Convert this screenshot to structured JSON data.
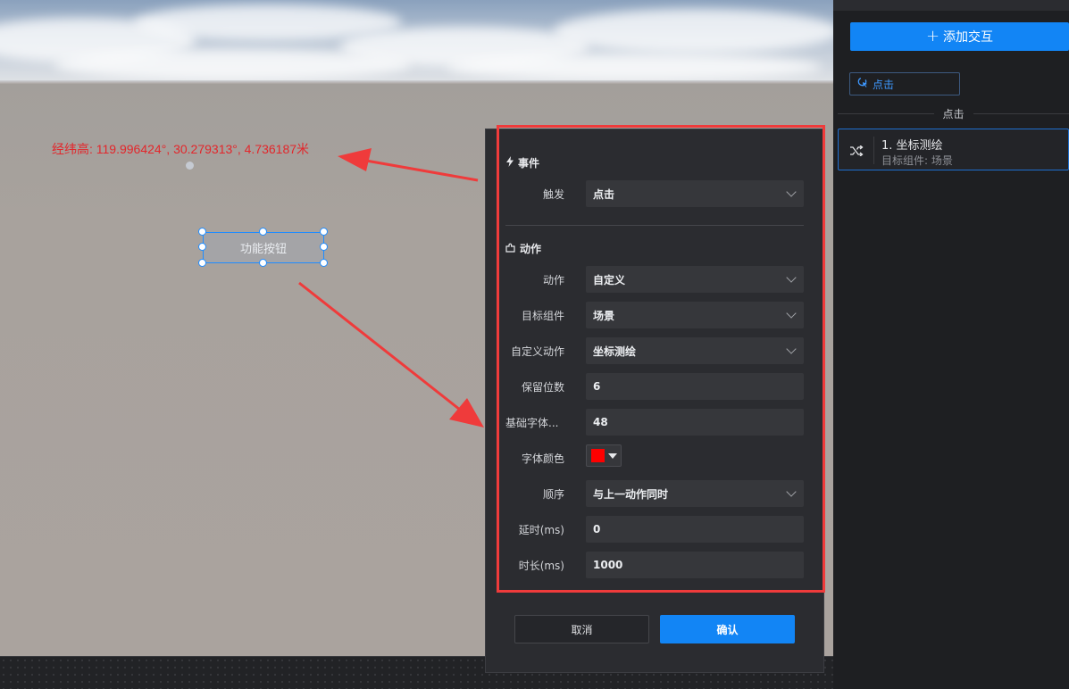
{
  "scene": {
    "coordinate_readout": "经纬高: 119.996424°, 30.279313°, 4.736187米",
    "function_button_label": "功能按钮",
    "annotation_color": "#ef3b3b"
  },
  "right_panel": {
    "add_interaction_label": "添加交互",
    "event_pill_label": "点击",
    "divider_label": "点击",
    "action_card": {
      "title": "1. 坐标测绘",
      "subtitle": "目标组件: 场景"
    }
  },
  "dialog": {
    "event_section_title": "事件",
    "trigger_label": "触发",
    "trigger_value": "点击",
    "action_section_title": "动作",
    "fields": {
      "action": {
        "label": "动作",
        "value": "自定义"
      },
      "target": {
        "label": "目标组件",
        "value": "场景"
      },
      "custom_action": {
        "label": "自定义动作",
        "value": "坐标测绘"
      },
      "decimals": {
        "label": "保留位数",
        "value": "6"
      },
      "base_font": {
        "label": "基础字体...",
        "value": "48"
      },
      "font_color": {
        "label": "字体颜色",
        "value": "#ff0000"
      },
      "order": {
        "label": "顺序",
        "value": "与上一动作同时"
      },
      "delay": {
        "label": "延时(ms)",
        "value": "0"
      },
      "duration": {
        "label": "时长(ms)",
        "value": "1000"
      }
    },
    "cancel_label": "取消",
    "confirm_label": "确认"
  },
  "colors": {
    "accent": "#1285f5",
    "panel_bg": "#2b2c30",
    "field_bg": "#36373b"
  }
}
